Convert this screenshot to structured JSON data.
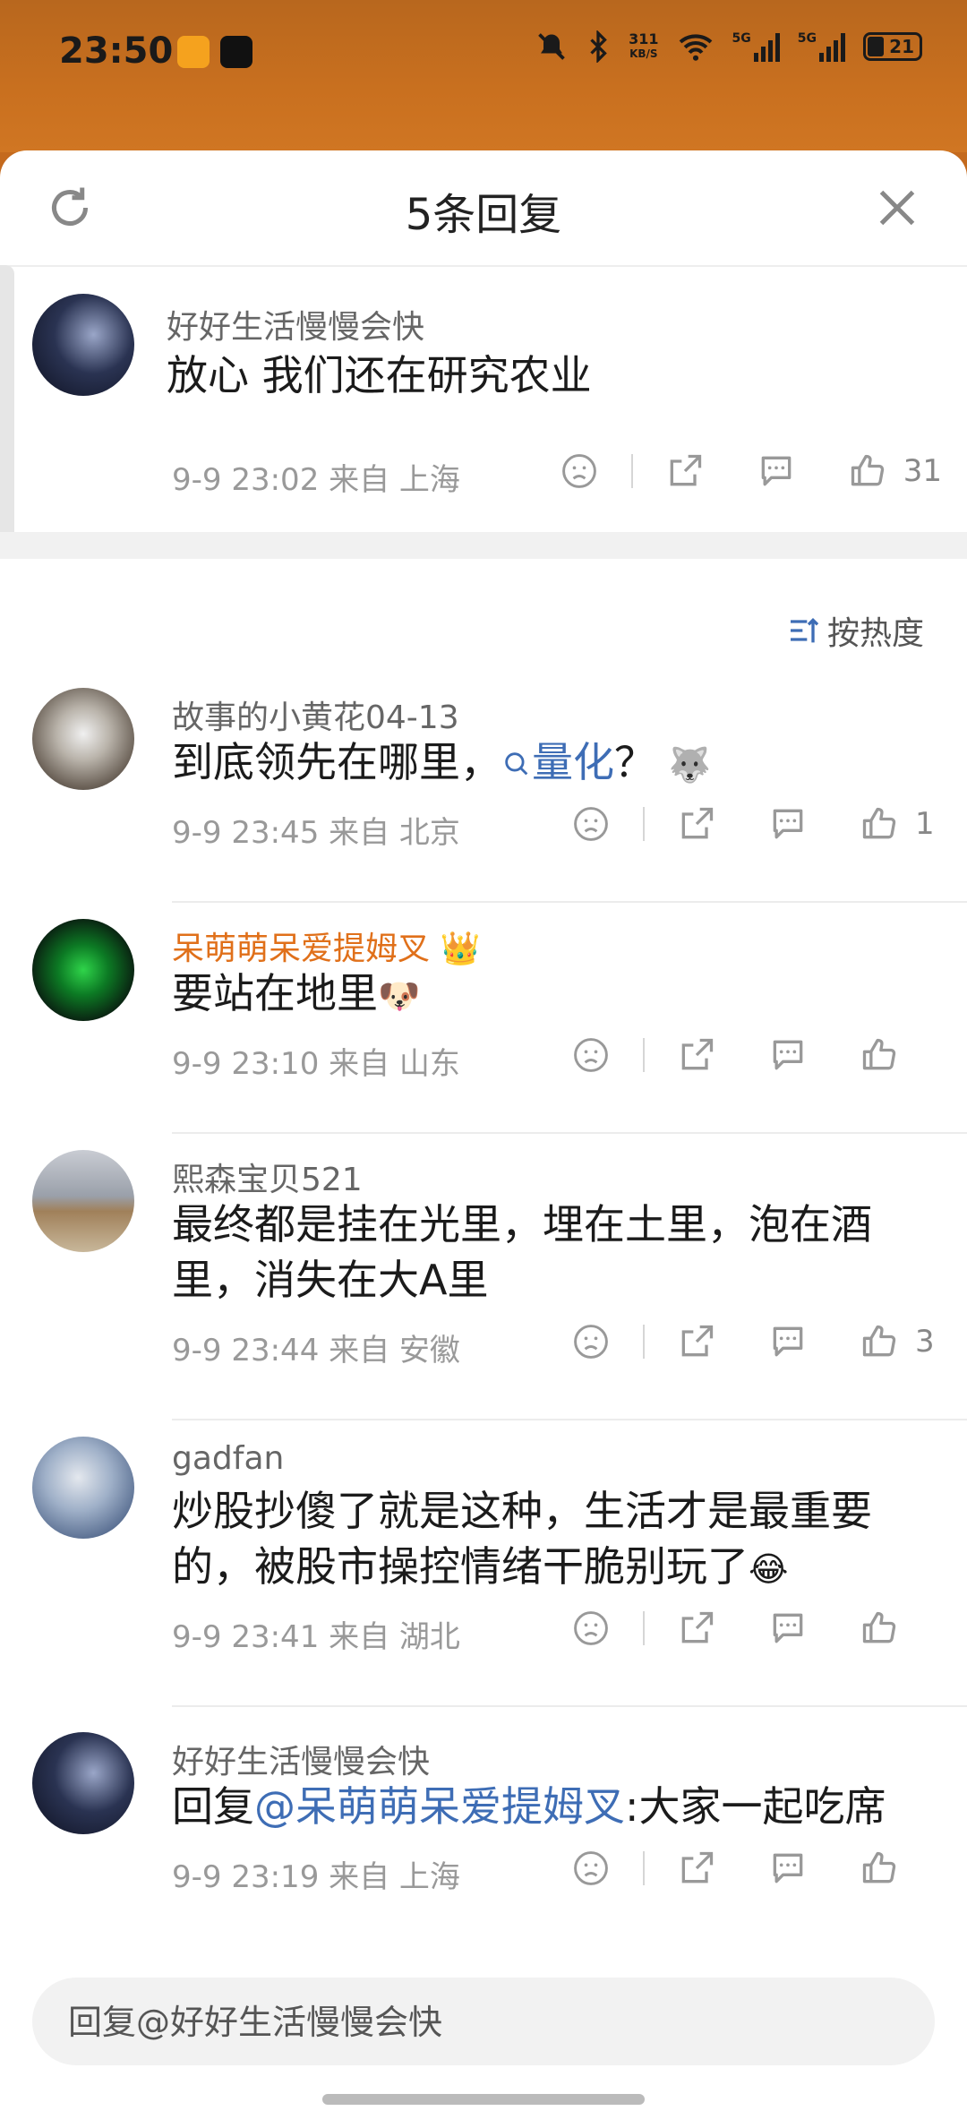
{
  "status_bar": {
    "time": "23:50",
    "net_speed_value": "311",
    "net_speed_unit": "KB/S",
    "battery": "21",
    "network_1": "5G",
    "network_2": "5G"
  },
  "sheet": {
    "title": "5条回复"
  },
  "sort": {
    "label": "按热度"
  },
  "root_comment": {
    "username": "好好生活慢慢会快",
    "text": "放心 我们还在研究农业",
    "meta": "9-9 23:02  来自 上海",
    "likes": "31"
  },
  "replies": [
    {
      "username": "故事的小黄花04-13",
      "text_before": "到底领先在哪里，",
      "topic_link": "量化",
      "text_after": "？",
      "emoji": "🐺",
      "meta": "9-9 23:45  来自 北京",
      "likes": "1"
    },
    {
      "username": "呆萌萌呆爱提姆叉",
      "crown": "👑",
      "text": "要站在地里",
      "emoji": "🐶",
      "meta": "9-9 23:10  来自 山东",
      "likes": ""
    },
    {
      "username": "熙森宝贝521",
      "text": "最终都是挂在光里，埋在土里，泡在酒里，消失在大A里",
      "meta": "9-9 23:44  来自 安徽",
      "likes": "3"
    },
    {
      "username": "gadfan",
      "text": "炒股抄傻了就是这种，生活才是最重要的，被股市操控情绪干脆别玩了",
      "emoji": "😂",
      "meta": "9-9 23:41  来自 湖北",
      "likes": ""
    },
    {
      "username": "好好生活慢慢会快",
      "reply_prefix": "回复",
      "mention": "@呆萌萌呆爱提姆叉",
      "text": ":大家一起吃席",
      "meta": "9-9 23:19  来自 上海",
      "likes": ""
    }
  ],
  "reply_input": {
    "placeholder": "回复@好好生活慢慢会快"
  },
  "colors": {
    "accent_link": "#3e6db5",
    "vip_name": "#e0701a",
    "header_bg": "#c46a1e"
  },
  "icons": [
    "refresh-icon",
    "close-icon",
    "dislike-icon",
    "share-icon",
    "comment-icon",
    "like-icon",
    "search-icon",
    "sort-icon",
    "mute-icon",
    "bluetooth-icon",
    "wifi-icon",
    "signal-icon",
    "battery-icon"
  ]
}
